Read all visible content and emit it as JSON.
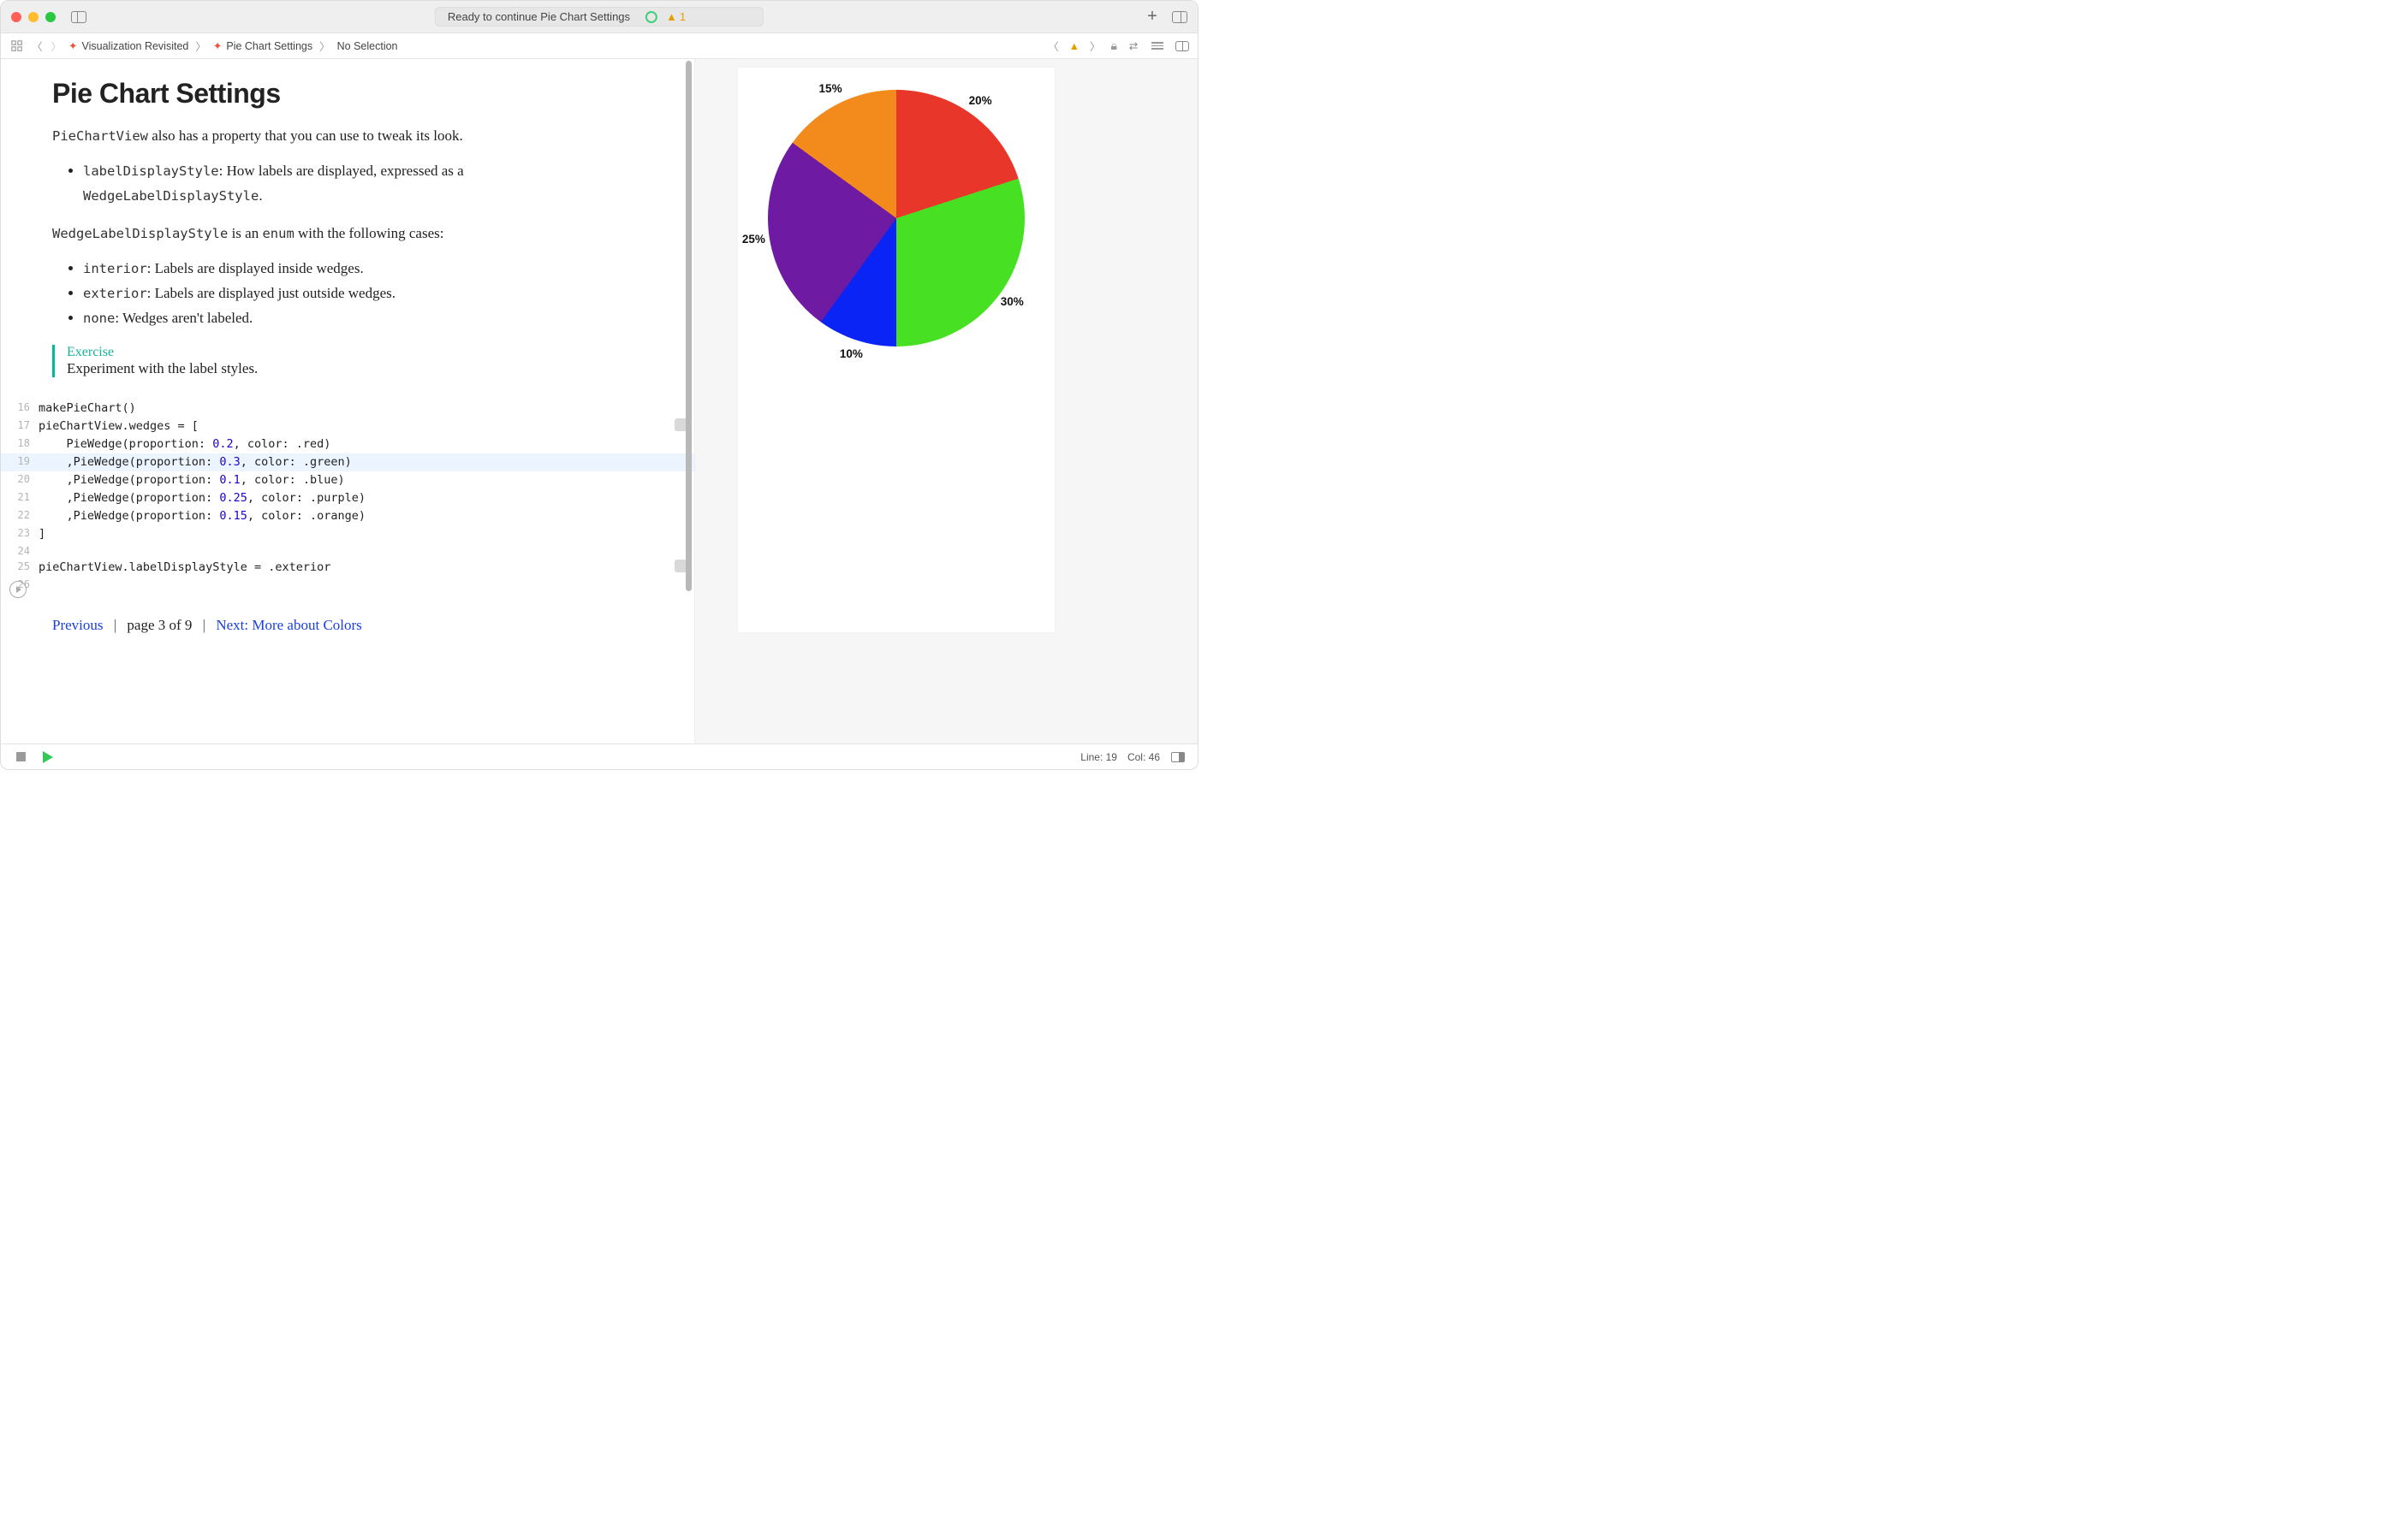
{
  "titlebar": {
    "status_text": "Ready to continue Pie Chart Settings",
    "warning_count": "1"
  },
  "breadcrumb": {
    "project": "Visualization Revisited",
    "file": "Pie Chart Settings",
    "selection": "No Selection"
  },
  "prose": {
    "h1": "Pie Chart Settings",
    "p1_code": "PieChartView",
    "p1_tail": " also has a property that you can use to tweak its look.",
    "bullet1_code": "labelDisplayStyle",
    "bullet1_mid": ": How labels are displayed, expressed as a ",
    "bullet1_code2": "WedgeLabelDisplayStyle",
    "bullet1_end": ".",
    "p2_code": "WedgeLabelDisplayStyle",
    "p2_mid": " is an ",
    "p2_code2": "enum",
    "p2_end": " with the following cases:",
    "bullet_a_code": "interior",
    "bullet_a_tail": ": Labels are displayed inside wedges.",
    "bullet_b_code": "exterior",
    "bullet_b_tail": ": Labels are displayed just outside wedges.",
    "bullet_c_code": "none",
    "bullet_c_tail": ": Wedges aren't labeled.",
    "exercise_label": "Exercise",
    "exercise_text": "Experiment with the label styles."
  },
  "code": {
    "start_line": 16,
    "lines": [
      "makePieChart()",
      "pieChartView.wedges = [",
      "    PieWedge(proportion: 0.2, color: .red)",
      "    ,PieWedge(proportion: 0.3, color: .green)",
      "    ,PieWedge(proportion: 0.1, color: .blue)",
      "    ,PieWedge(proportion: 0.25, color: .purple)",
      "    ,PieWedge(proportion: 0.15, color: .orange)",
      "]",
      "",
      "pieChartView.labelDisplayStyle = .exterior",
      ""
    ],
    "highlighted_line": 19,
    "inline_result_lines": [
      17,
      25
    ]
  },
  "pager": {
    "prev": "Previous",
    "page_text": "page 3 of 9",
    "next": "Next: More about Colors"
  },
  "chart_data": {
    "type": "pie",
    "series": [
      {
        "name": "red",
        "value": 0.2,
        "label": "20%",
        "color": "#e8362a"
      },
      {
        "name": "green",
        "value": 0.3,
        "label": "30%",
        "color": "#47e023"
      },
      {
        "name": "blue",
        "value": 0.1,
        "label": "10%",
        "color": "#0b24f6"
      },
      {
        "name": "purple",
        "value": 0.25,
        "label": "25%",
        "color": "#6f1aa2"
      },
      {
        "name": "orange",
        "value": 0.15,
        "label": "15%",
        "color": "#f28a1c"
      }
    ],
    "label_style": "exterior"
  },
  "statusbar": {
    "line": "Line: 19",
    "col": "Col: 46"
  }
}
